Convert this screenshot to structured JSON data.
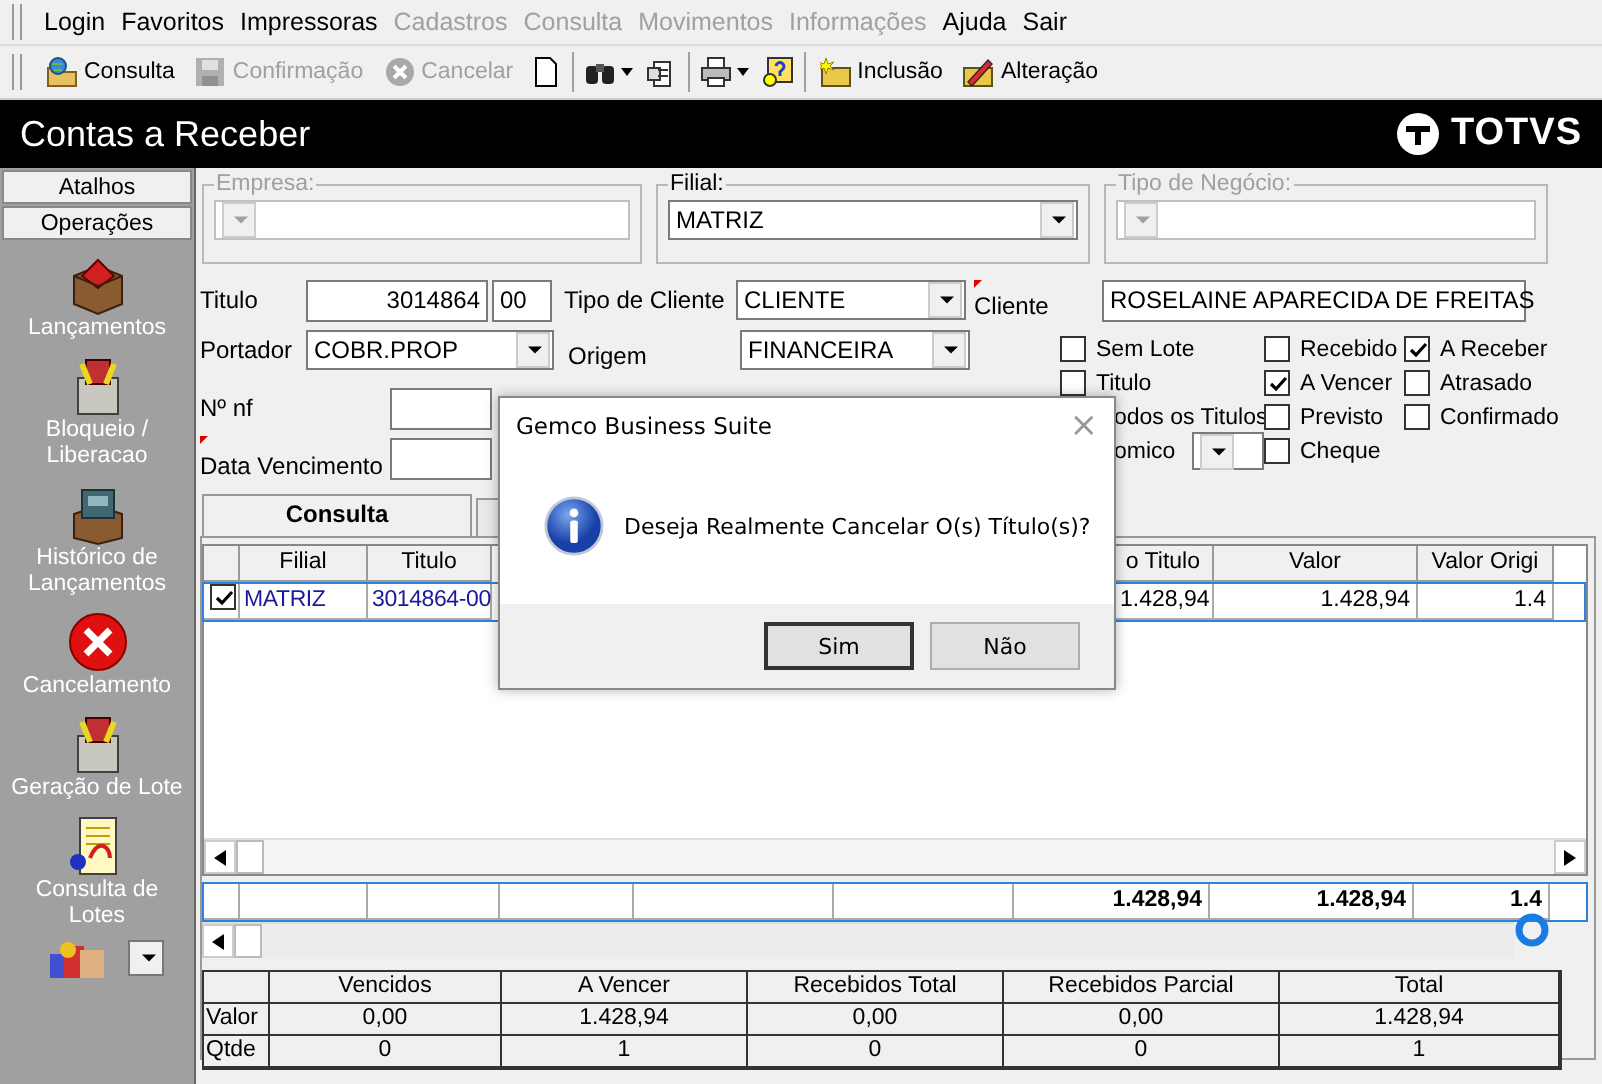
{
  "menu": [
    {
      "label": "Login",
      "disabled": false
    },
    {
      "label": "Favoritos",
      "disabled": false
    },
    {
      "label": "Impressoras",
      "disabled": false
    },
    {
      "label": "Cadastros",
      "disabled": true
    },
    {
      "label": "Consulta",
      "disabled": true
    },
    {
      "label": "Movimentos",
      "disabled": true
    },
    {
      "label": "Informações",
      "disabled": true
    },
    {
      "label": "Ajuda",
      "disabled": false
    },
    {
      "label": "Sair",
      "disabled": false
    }
  ],
  "toolbar": [
    {
      "kind": "text",
      "label": "Consulta",
      "disabled": false
    },
    {
      "kind": "text",
      "label": "Confirmação",
      "disabled": true
    },
    {
      "kind": "text",
      "label": "Cancelar",
      "disabled": true
    },
    {
      "kind": "icon"
    },
    {
      "kind": "sep"
    },
    {
      "kind": "icon",
      "dropdown": true
    },
    {
      "kind": "icon"
    },
    {
      "kind": "sep"
    },
    {
      "kind": "icon",
      "dropdown": true
    },
    {
      "kind": "icon"
    },
    {
      "kind": "sep"
    },
    {
      "kind": "text",
      "label": "Inclusão",
      "disabled": false
    },
    {
      "kind": "text",
      "label": "Alteração",
      "disabled": false
    }
  ],
  "window": {
    "title": "Contas a Receber",
    "logo": "TOTVS"
  },
  "sidebar": {
    "tabs": [
      "Atalhos",
      "Operações"
    ],
    "items": [
      {
        "label": "Lançamentos"
      },
      {
        "label": "Bloqueio / Liberacao"
      },
      {
        "label": "Histórico de Lançamentos"
      },
      {
        "label": "Cancelamento"
      },
      {
        "label": "Geração de Lote"
      },
      {
        "label": "Consulta de Lotes"
      }
    ]
  },
  "groups": [
    {
      "legend": "Empresa:",
      "disabled": true
    },
    {
      "legend": "Filial:",
      "disabled": false,
      "value": "MATRIZ"
    },
    {
      "legend": "Tipo de Negócio:",
      "disabled": true
    }
  ],
  "form": {
    "titulo_label": "Titulo",
    "titulo": "3014864",
    "titulo_suffix": "00",
    "tipo_cliente_label": "Tipo de Cliente",
    "tipo_cliente": "CLIENTE",
    "cliente_label": "Cliente",
    "cliente": "ROSELAINE APARECIDA DE FREITAS",
    "portador_label": "Portador",
    "portador": "COBR.PROP",
    "origem_label": "Origem",
    "origem": "FINANCEIRA",
    "nf_label": "Nº nf",
    "vencimento_label": "Data Vencimento"
  },
  "checkboxes": [
    {
      "kind": "checkbox",
      "label": "Sem Lote",
      "checked": false
    },
    {
      "kind": "checkbox",
      "label": "Recebido",
      "checked": false
    },
    {
      "kind": "checkbox",
      "label": "A Receber",
      "checked": true
    },
    {
      "kind": "checkbox",
      "label": "Titulo",
      "checked": false
    },
    {
      "kind": "checkbox",
      "label": "A Vencer",
      "checked": true
    },
    {
      "kind": "checkbox",
      "label": "Atrasado",
      "checked": false
    },
    {
      "kind": "partial",
      "label": "odos os Titulos"
    },
    {
      "kind": "checkbox",
      "label": "Previsto",
      "checked": false
    },
    {
      "kind": "checkbox",
      "label": "Confirmado",
      "checked": false
    },
    {
      "kind": "partial-select",
      "label": "omico"
    },
    {
      "kind": "checkbox",
      "label": "Cheque",
      "checked": false
    }
  ],
  "tabs": [
    {
      "label": "Consulta",
      "selected": true
    },
    {
      "selected": false
    }
  ],
  "grid": {
    "columns": [
      "Filial",
      "Titulo",
      "o Titulo",
      "Valor",
      "Valor Origi"
    ],
    "rows": [
      {
        "checked": true,
        "cells": [
          "MATRIZ",
          "3014864-00",
          "1.428,94",
          "1.428,94",
          "1.4"
        ]
      }
    ],
    "totals": [
      "1.428,94",
      "1.428,94",
      "1.4"
    ]
  },
  "summary": {
    "columns": [
      "Vencidos",
      "A Vencer",
      "Recebidos Total",
      "Recebidos Parcial",
      "Total"
    ],
    "rows": [
      {
        "label": "Valor",
        "values": [
          "0,00",
          "1.428,94",
          "0,00",
          "0,00",
          "1.428,94"
        ]
      },
      {
        "label": "Qtde",
        "values": [
          "0",
          "1",
          "0",
          "0",
          "1"
        ]
      }
    ]
  },
  "dialog": {
    "title": "Gemco Business Suite",
    "close": "×",
    "message": "Deseja Realmente Cancelar O(s) Título(s)?",
    "buttons": [
      "Sim",
      "Não"
    ]
  }
}
